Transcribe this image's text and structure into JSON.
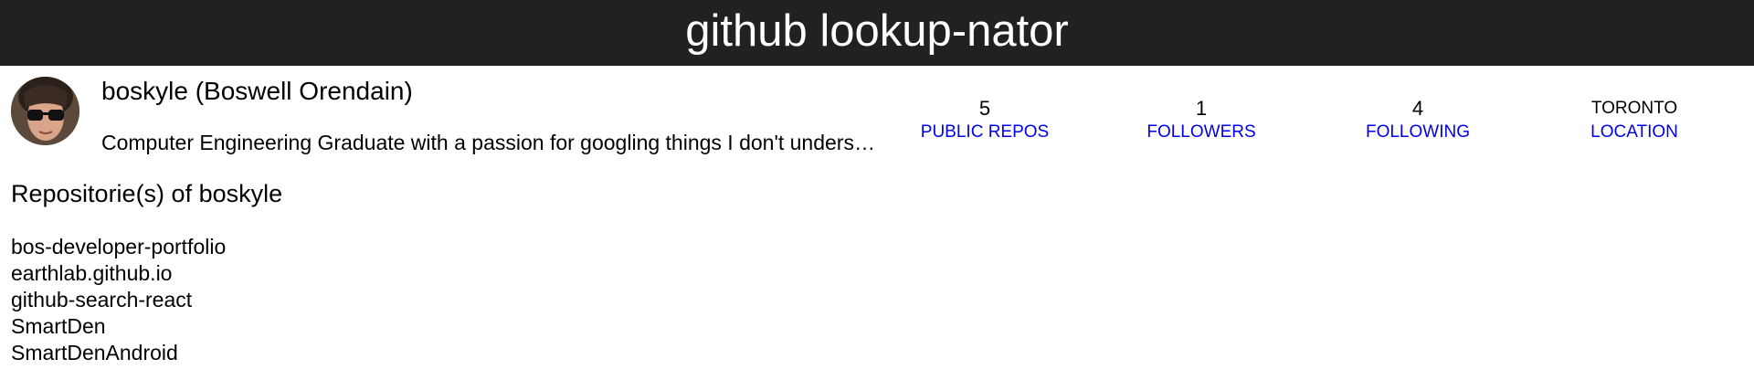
{
  "app": {
    "title": "github lookup-nator"
  },
  "profile": {
    "name": "boskyle (Boswell Orendain)",
    "bio": "Computer Engineering Graduate with a passion for googling things I don't understand",
    "avatar_icon": "user-avatar-photo"
  },
  "stats": {
    "public_repos": {
      "value": "5",
      "label": "Public Repos"
    },
    "followers": {
      "value": "1",
      "label": "Followers"
    },
    "following": {
      "value": "4",
      "label": "Following"
    },
    "location": {
      "value": "Toronto",
      "label": "Location"
    }
  },
  "repositories": {
    "title": "Repositorie(s) of boskyle",
    "items": [
      "bos-developer-portfolio",
      "earthlab.github.io",
      "github-search-react",
      "SmartDen",
      "SmartDenAndroid"
    ]
  },
  "colors": {
    "header_bg": "#212121",
    "link": "#0000ee"
  }
}
